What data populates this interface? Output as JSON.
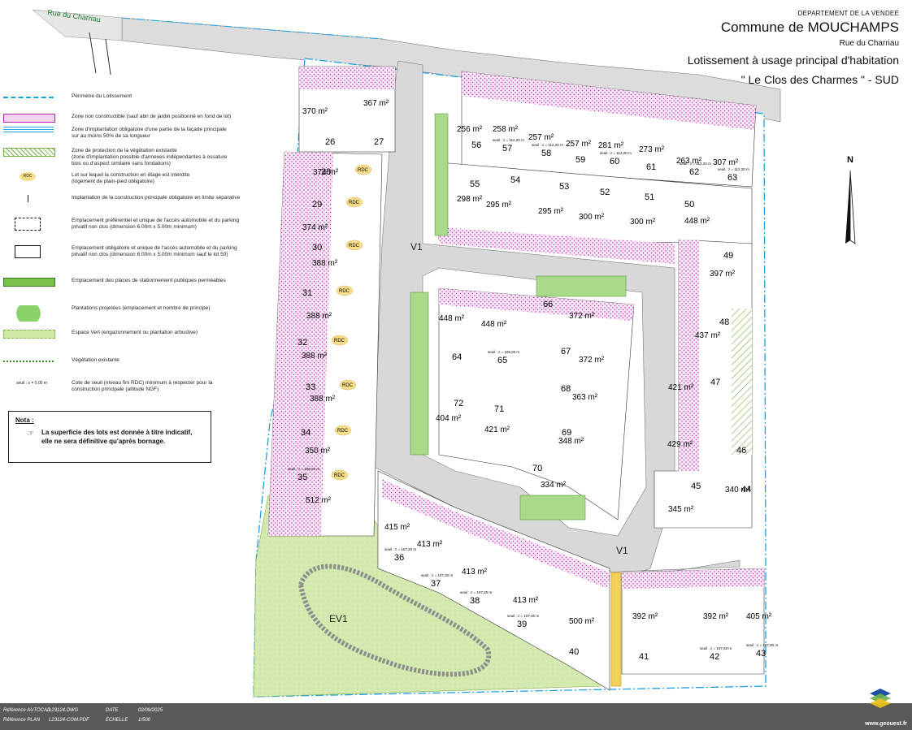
{
  "header": {
    "department": "DEPARTEMENT DE LA VENDEE",
    "commune": "Commune de MOUCHAMPS",
    "street": "Rue du Charriau",
    "title_line1": "Lotissement à usage principal d'habitation",
    "title_line2": "\" Le Clos des Charmes \" - SUD"
  },
  "street_label": "Rue du Charriau",
  "north_label": "N",
  "legend": [
    {
      "icon": "perimeter-line",
      "text": "Périmètre du Lotissement"
    },
    {
      "icon": "non-buildable-zone",
      "text": "Zone non constructible (sauf abri de jardin positionné en fond de lot)"
    },
    {
      "icon": "facade-zone",
      "text": "Zone d'implantation obligatoire d'une partie de la façade principale\nsur au moins 50% de sa longueur"
    },
    {
      "icon": "vegetation-protection",
      "text": "Zone de protection de la végétation existante\n(zone d'implantation possible d'annexes indépendantes à ossature\nbois ou d'aspect similaire sans fondations)"
    },
    {
      "icon": "rdc-marker",
      "label": "RDC",
      "text": "Lot sur lequel la construction en étage est interdite\n(logement de plain-pied obligatoire)"
    },
    {
      "icon": "boundary-marker",
      "text": "Implantation de la construction principale obligatoire en limite séparative"
    },
    {
      "icon": "preferred-access",
      "text": "Emplacement préférentiel et unique de l'accès automobile et du parking\nprivatif non clos (dimension 6.00m x 5.00m minimum)"
    },
    {
      "icon": "mandatory-access",
      "text": "Emplacement obligatoire et unique de l'accès automobile et du parking\nprivatif non clos (dimension 6.00m x 5.00m minimum sauf le lot 50)"
    },
    {
      "icon": "public-parking",
      "text": "Emplacement des places de stationnement publiques perméables"
    },
    {
      "icon": "projected-plantings",
      "text": "Plantations projetées (emplacement et nombre de principe)"
    },
    {
      "icon": "green-space",
      "text": "Espace Vert (engazonnement ou plantation arbustive)"
    },
    {
      "icon": "existing-vegetation",
      "text": "Végétation existante"
    },
    {
      "icon": "threshold-level",
      "label": "seuil : z = 0,00 m",
      "text": "Cote de seuil (niveau fini RDC) minimum à respecter pour la\nconstruction principale (altitude NGF)"
    }
  ],
  "note": {
    "title": "Nota :",
    "text": "La superficie des lots est donnée à titre indicatif, elle ne sera définitive qu'après bornage."
  },
  "roads": {
    "v1": "V1",
    "ev1": "EV1"
  },
  "colors": {
    "lot_hatch": "#c026b4",
    "facade_zone": "#2aa8e6",
    "green_space": "#cfe8a6",
    "road": "#d4d4d4",
    "parking": "#7ac14a",
    "footer": "#595959"
  },
  "lots": [
    {
      "num": "26",
      "area": "370 m²"
    },
    {
      "num": "27",
      "area": "367 m²"
    },
    {
      "num": "28",
      "area": "374 m²",
      "rdc": true
    },
    {
      "num": "29",
      "area": "374 m²",
      "rdc": true
    },
    {
      "num": "30",
      "area": "388 m²",
      "rdc": true
    },
    {
      "num": "31",
      "area": "388 m²",
      "rdc": true
    },
    {
      "num": "32",
      "area": "388 m²",
      "rdc": true
    },
    {
      "num": "33",
      "area": "388 m²",
      "rdc": true
    },
    {
      "num": "34",
      "area": "350 m²",
      "rdc": true
    },
    {
      "num": "35",
      "area": "512 m²",
      "rdc": true,
      "seuil": "seuil : z = 106,90 m"
    },
    {
      "num": "36",
      "area": "415 m²",
      "seuil": "seuil : z = 107,20 m"
    },
    {
      "num": "37",
      "area": "413 m²",
      "seuil": "seuil : z = 107,20 m"
    },
    {
      "num": "38",
      "area": "413 m²",
      "seuil": "seuil : z = 107,20 m"
    },
    {
      "num": "39",
      "area": "413 m²",
      "seuil": "seuil : z = 107,40 m"
    },
    {
      "num": "40",
      "area": "500 m²"
    },
    {
      "num": "41",
      "area": "392 m²"
    },
    {
      "num": "42",
      "area": "392 m²",
      "seuil": "seuil : z = 107,60 m"
    },
    {
      "num": "43",
      "area": "405 m²",
      "seuil": "seuil : z = 107,80 m"
    },
    {
      "num": "44",
      "area": "340 m²"
    },
    {
      "num": "45",
      "area": "345 m²"
    },
    {
      "num": "46",
      "area": "429 m²"
    },
    {
      "num": "47",
      "area": "421 m²"
    },
    {
      "num": "48",
      "area": "437 m²"
    },
    {
      "num": "49",
      "area": "397 m²"
    },
    {
      "num": "50",
      "area": "448 m²"
    },
    {
      "num": "51",
      "area": "300 m²"
    },
    {
      "num": "52",
      "area": "300 m²"
    },
    {
      "num": "53",
      "area": "295 m²"
    },
    {
      "num": "54",
      "area": "295 m²"
    },
    {
      "num": "55",
      "area": "298 m²"
    },
    {
      "num": "56",
      "area": "256 m²"
    },
    {
      "num": "57",
      "area": "258 m²",
      "seuil": "seuil : z = 112,20 m"
    },
    {
      "num": "58",
      "area": "257 m²",
      "seuil": "seuil : z = 112,20 m"
    },
    {
      "num": "59",
      "area": "257 m²"
    },
    {
      "num": "60",
      "area": "281 m²",
      "seuil": "seuil : z = 112,20 m"
    },
    {
      "num": "61",
      "area": "273 m²"
    },
    {
      "num": "62",
      "area": "263 m²",
      "seuil": "seuil : z = 112,20 m"
    },
    {
      "num": "63",
      "area": "307 m²",
      "seuil": "seuil : z = 112,20 m"
    },
    {
      "num": "64",
      "area": "448 m²"
    },
    {
      "num": "65",
      "area": "448 m²",
      "seuil": "seuil : z = 109,00 m"
    },
    {
      "num": "66",
      "area": "372 m²"
    },
    {
      "num": "67",
      "area": "372 m²"
    },
    {
      "num": "68",
      "area": "363 m²"
    },
    {
      "num": "69",
      "area": "348 m²"
    },
    {
      "num": "70",
      "area": "334 m²"
    },
    {
      "num": "71",
      "area": "421 m²"
    },
    {
      "num": "72",
      "area": "404 m²"
    }
  ],
  "footer": {
    "ref_autocad_label": "Référence AUTOCAD",
    "ref_autocad": "L23124.DWG",
    "ref_plan_label": "Référence PLAN",
    "ref_plan": "L23124-COM.PDF",
    "date_label": "DATE",
    "date": "02/09/2025",
    "scale_label": "ECHELLE",
    "scale": "1/500",
    "brand": "www.geouest.fr"
  }
}
